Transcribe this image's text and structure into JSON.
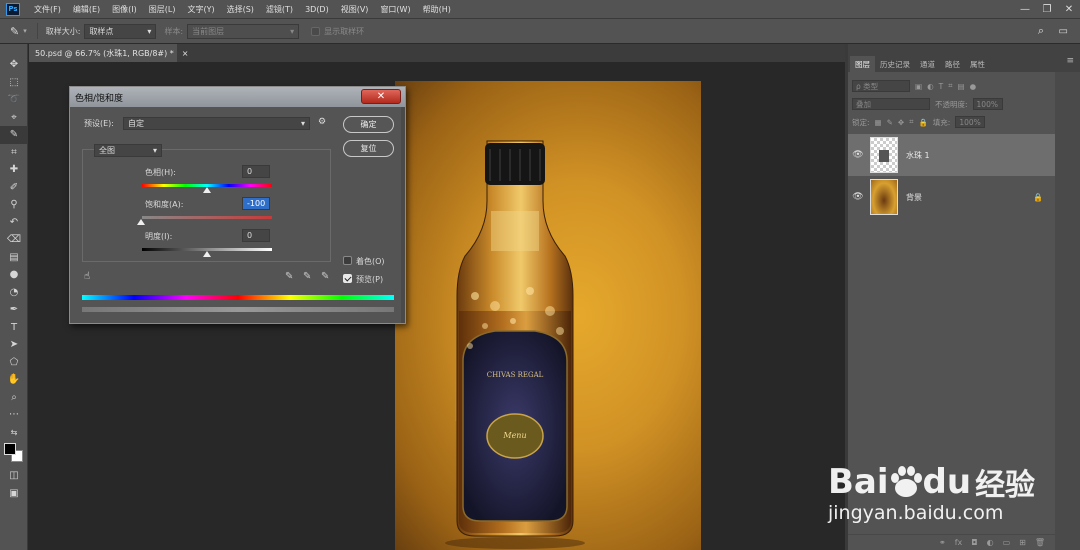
{
  "menubar": {
    "logo": "Ps",
    "items": [
      "文件(F)",
      "编辑(E)",
      "图像(I)",
      "图层(L)",
      "文字(Y)",
      "选择(S)",
      "滤镜(T)",
      "3D(D)",
      "视图(V)",
      "窗口(W)",
      "帮助(H)"
    ],
    "minimize": "—",
    "restore": "❐",
    "close": "✕"
  },
  "options": {
    "sample_size_label": "取样大小:",
    "sample_size_value": "取样点",
    "sample_label": "样本:",
    "sample_value": "当前图层",
    "show_ring_label": "显示取样环"
  },
  "document": {
    "tab_label": "50.psd @ 66.7% (水珠1, RGB/8#) *",
    "tab_close": "×"
  },
  "dialog": {
    "title": "色相/饱和度",
    "close": "✕",
    "preset_label": "预设(E):",
    "preset_value": "自定",
    "ok_label": "确定",
    "reset_label": "复位",
    "channel_value": "全图",
    "hue_label": "色相(H):",
    "hue_value": "0",
    "saturation_label": "饱和度(A):",
    "saturation_value": "-100",
    "lightness_label": "明度(I):",
    "lightness_value": "0",
    "colorize_label": "着色(O)",
    "preview_label": "预览(P)",
    "colorize_checked": false,
    "preview_checked": true
  },
  "layers_panel": {
    "tabs": [
      "图层",
      "历史记录",
      "通道",
      "路径",
      "属性"
    ],
    "kind_label": "ρ 类型",
    "blend_mode": "叠加",
    "opacity_label": "不透明度:",
    "opacity_value": "100%",
    "lock_label": "锁定:",
    "fill_label": "填充:",
    "fill_value": "100%",
    "layers": [
      {
        "name": "水珠 1",
        "selected": true,
        "locked": false
      },
      {
        "name": "背景",
        "selected": false,
        "locked": true
      }
    ]
  },
  "photo": {
    "bottle_label_text": "CHIVAS REGAL",
    "bottle_sub_text": "Menu"
  },
  "watermark": {
    "brand": "Bai",
    "brand2": "du",
    "brand_cn": "经验",
    "url": "jingyan.baidu.com"
  },
  "colors": {
    "ui_bg": "#535353",
    "canvas_bg": "#282828",
    "accent_blue": "#31a8ff",
    "close_red": "#c8372b"
  }
}
